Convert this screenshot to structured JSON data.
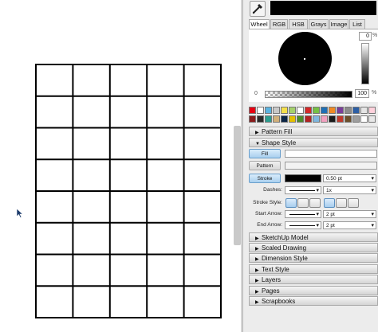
{
  "color_tabs": [
    "Wheel",
    "RGB",
    "HSB",
    "Grays",
    "Image",
    "List"
  ],
  "wheel": {
    "brightness_value": "0",
    "brightness_unit": "%",
    "opacity_label": "0",
    "opacity_value": "100",
    "opacity_unit": "%"
  },
  "swatches": [
    "#e60012",
    "#ffffff",
    "#5bb3e0",
    "#c8c8c8",
    "#f5e04a",
    "#a5d16c",
    "#ffffff",
    "#d62727",
    "#76c043",
    "#1f6fb5",
    "#f08a24",
    "#7a3d9a",
    "#8c8c8c",
    "#2d5fa5",
    "#e5e5e5",
    "#ffd1dc",
    "#8a1c1c",
    "#2a2a2a",
    "#2a9d8f",
    "#d1b07a",
    "#0b2545",
    "#e4c000",
    "#4c8c2b",
    "#b22222",
    "#7fb7e0",
    "#f2a1c0",
    "#1a1a1a",
    "#c0392b",
    "#6b4f2a",
    "#9e9e9e",
    "#ffffff",
    "#e8e8e8"
  ],
  "panels": {
    "pattern_fill": "Pattern Fill",
    "shape_style": "Shape Style",
    "sketchup_model": "SketchUp Model",
    "scaled_drawing": "Scaled Drawing",
    "dimension_style": "Dimension Style",
    "text_style": "Text Style",
    "layers": "Layers",
    "pages": "Pages",
    "scrapbooks": "Scrapbooks"
  },
  "shape_style": {
    "fill_label": "Fill",
    "pattern_label": "Pattern",
    "stroke_label": "Stroke",
    "stroke_width": "0.50 pt",
    "dashes_label": "Dashes:",
    "dashes_scale": "1x",
    "stroke_style_label": "Stroke Style:",
    "start_arrow_label": "Start Arrow:",
    "start_arrow_size": "2 pt",
    "end_arrow_label": "End Arrow:",
    "end_arrow_size": "2 pt"
  },
  "grid": {
    "rows": 8,
    "cols": 5
  }
}
